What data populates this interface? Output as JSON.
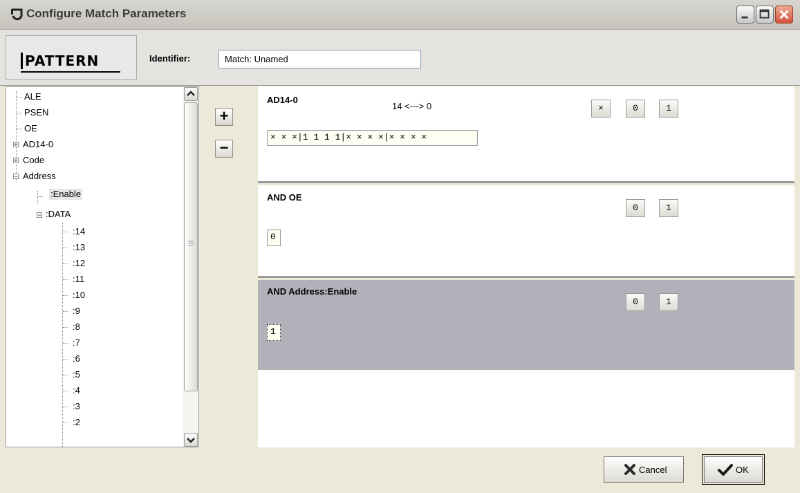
{
  "window": {
    "title": "Configure Match Parameters"
  },
  "header": {
    "logo_text": "PATTERN",
    "identifier_label": "Identifier:",
    "identifier_value": "Match: Unamed"
  },
  "tree": {
    "items": [
      {
        "label": "ALE"
      },
      {
        "label": "PSEN"
      },
      {
        "label": "OE"
      },
      {
        "label": "AD14-0",
        "expander": "+"
      },
      {
        "label": "Code",
        "expander": "+"
      },
      {
        "label": "Address",
        "expander": "−"
      },
      {
        "label": ":Enable",
        "selected": true
      },
      {
        "label": ":DATA",
        "expander": "−"
      },
      {
        "label": ":14"
      },
      {
        "label": ":13"
      },
      {
        "label": ":12"
      },
      {
        "label": ":11"
      },
      {
        "label": ":10"
      },
      {
        "label": ":9"
      },
      {
        "label": ":8"
      },
      {
        "label": ":7"
      },
      {
        "label": ":6"
      },
      {
        "label": ":5"
      },
      {
        "label": ":4"
      },
      {
        "label": ":3"
      },
      {
        "label": ":2"
      }
    ]
  },
  "controls": {
    "add_label": "+",
    "remove_label": "−"
  },
  "panels": [
    {
      "title": "AD14-0",
      "range": "14 <---> 0",
      "bits": "× × ×|1 1 1 1|× × × ×|× × × ×",
      "buttons": [
        "×",
        "0",
        "1"
      ]
    },
    {
      "title": "AND  OE",
      "bits": "0",
      "buttons": [
        "0",
        "1"
      ]
    },
    {
      "title": "AND  Address:Enable",
      "bits": "1",
      "buttons": [
        "0",
        "1"
      ]
    }
  ],
  "footer": {
    "cancel_label": "Cancel",
    "ok_label": "OK"
  },
  "colors": {
    "selected_panel_bg": "#b1b1b9",
    "cancel_icon": "#2b2b2b",
    "ok_icon": "#1a1a1a"
  }
}
